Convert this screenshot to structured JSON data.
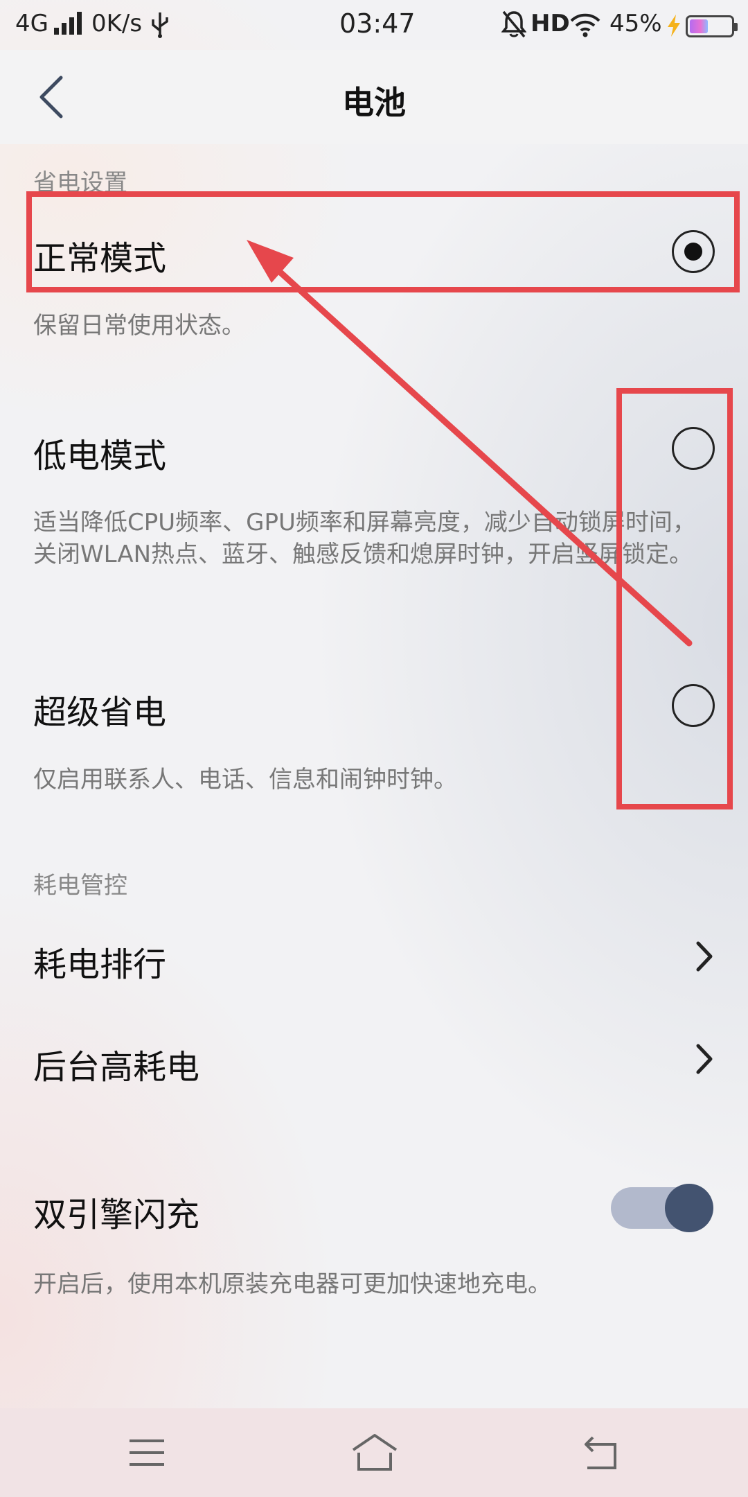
{
  "status_bar": {
    "network": "4G",
    "speed": "0K/s",
    "time": "03:47",
    "hd": "HD",
    "battery_percent": "45%",
    "battery_level": 0.45,
    "icons": [
      "signal-icon",
      "usb-icon",
      "mute-icon",
      "wifi-icon",
      "charging-icon",
      "battery-icon"
    ]
  },
  "header": {
    "title": "电池",
    "back_icon": "chevron-left-icon"
  },
  "power_saving": {
    "section_label": "省电设置",
    "modes": [
      {
        "title": "正常模式",
        "description": "保留日常使用状态。",
        "selected": true
      },
      {
        "title": "低电模式",
        "description": "适当降低CPU频率、GPU频率和屏幕亮度，减少自动锁屏时间，关闭WLAN热点、蓝牙、触感反馈和熄屏时钟，开启竖屏锁定。",
        "selected": false
      },
      {
        "title": "超级省电",
        "description": "仅启用联系人、电话、信息和闹钟时钟。",
        "selected": false
      }
    ]
  },
  "power_control": {
    "section_label": "耗电管控",
    "items": [
      {
        "title": "耗电排行"
      },
      {
        "title": "后台高耗电"
      }
    ]
  },
  "flash_charge": {
    "title": "双引擎闪充",
    "description": "开启后，使用本机原装充电器可更加快速地充电。",
    "enabled": true
  },
  "annotation": {
    "color": "#e6474c"
  },
  "nav_bar": {
    "icons": [
      "menu-icon",
      "home-icon",
      "back-icon"
    ]
  }
}
